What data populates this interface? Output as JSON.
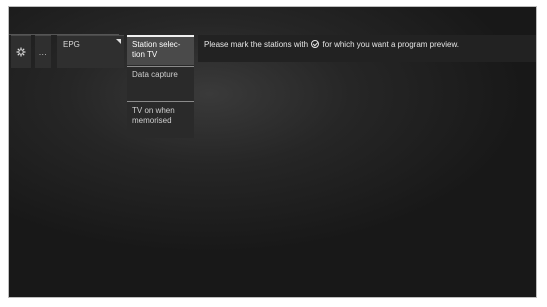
{
  "menu": {
    "tabs": [
      {
        "icon": "gear-icon"
      },
      {
        "label": "..."
      },
      {
        "label": "EPG"
      }
    ],
    "submenu": [
      {
        "label": "Station selec-tion TV",
        "selected": true
      },
      {
        "label": "Data capture"
      },
      {
        "label": "TV on when memorised"
      }
    ]
  },
  "info": {
    "text_before": "Please mark the stations with",
    "icon": "mark-icon",
    "text_after": "for which you want a program preview."
  }
}
